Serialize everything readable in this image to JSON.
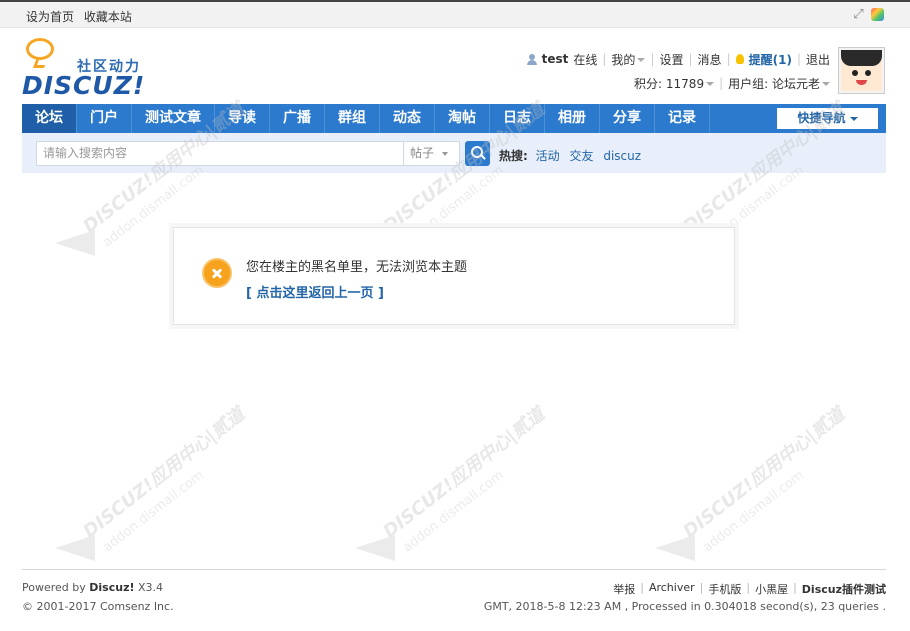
{
  "topbar": {
    "set_home": "设为首页",
    "bookmark": "收藏本站"
  },
  "logo": {
    "slogan": "社区动力",
    "wordmark": "DISCUZ!"
  },
  "user_menu": {
    "username": "test",
    "status": "在线",
    "my": "我的",
    "settings": "设置",
    "messages": "消息",
    "notice": "提醒(1)",
    "logout": "退出",
    "credits": "积分: 11789",
    "usergroup": "用户组: 论坛元老"
  },
  "nav": {
    "items": [
      {
        "label": "论坛"
      },
      {
        "label": "门户"
      },
      {
        "label": "测试文章"
      },
      {
        "label": "导读"
      },
      {
        "label": "广播"
      },
      {
        "label": "群组"
      },
      {
        "label": "动态"
      },
      {
        "label": "淘帖"
      },
      {
        "label": "日志"
      },
      {
        "label": "相册"
      },
      {
        "label": "分享"
      },
      {
        "label": "记录"
      }
    ],
    "quick_nav": "快捷导航"
  },
  "search": {
    "placeholder": "请输入搜索内容",
    "type": "帖子",
    "hot_label": "热搜:",
    "hot_keywords": [
      "活动",
      "交友",
      "discuz"
    ]
  },
  "watermark": {
    "brand": "DISCUZ!应用中心|贰道",
    "url": "addon.dismall.com"
  },
  "message": {
    "text": "您在楼主的黑名单里，无法浏览本主题",
    "link": "[ 点击这里返回上一页 ]"
  },
  "footer": {
    "powered_prefix": "Powered by",
    "powered_brand": "Discuz!",
    "version": "X3.4",
    "copyright": "© 2001-2017 Comsenz Inc.",
    "links": [
      "举报",
      "Archiver",
      "手机版",
      "小黑屋"
    ],
    "site_name": "Discuz插件测试",
    "stats": "GMT, 2018-5-8 12:23 AM , Processed in 0.304018 second(s), 23 queries ."
  },
  "colors": {
    "nav_bg": "#2b7acd",
    "nav_active": "#1f5fa8",
    "link": "#2366a8",
    "alert": "#f6a21c"
  }
}
